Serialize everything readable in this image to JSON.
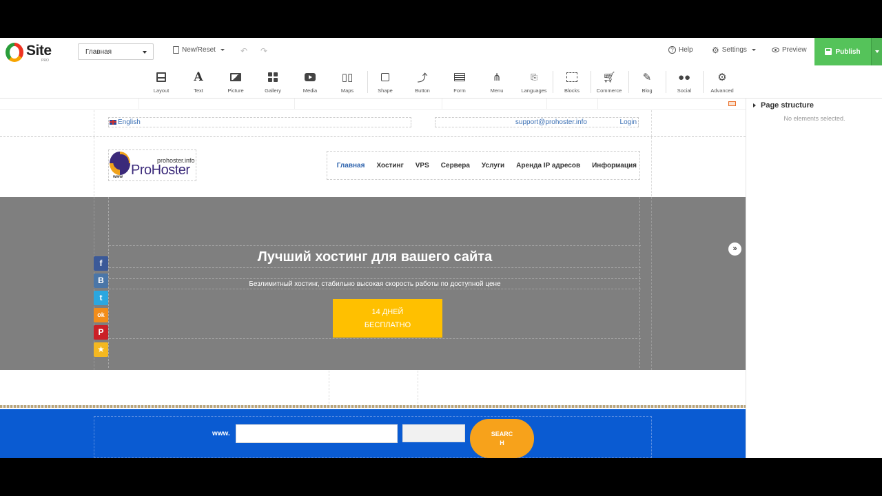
{
  "brand": {
    "name": "Site",
    "sub": "PRO"
  },
  "page_select": {
    "value": "Главная"
  },
  "topbar": {
    "new_reset": "New/Reset",
    "undo": "↶",
    "redo": "↷",
    "help": "Help",
    "settings": "Settings",
    "preview": "Preview",
    "publish": "Publish"
  },
  "tools": [
    {
      "label": "Layout",
      "icon": "layout-icon"
    },
    {
      "label": "Text",
      "icon": "text-icon"
    },
    {
      "label": "Picture",
      "icon": "picture-icon"
    },
    {
      "label": "Gallery",
      "icon": "gallery-icon"
    },
    {
      "label": "Media",
      "icon": "media-icon"
    },
    {
      "label": "Maps",
      "icon": "maps-icon"
    },
    {
      "label": "Shape",
      "icon": "shape-icon"
    },
    {
      "label": "Button",
      "icon": "button-icon"
    },
    {
      "label": "Form",
      "icon": "form-icon"
    },
    {
      "label": "Menu",
      "icon": "menu-icon"
    },
    {
      "label": "Languages",
      "icon": "languages-icon"
    },
    {
      "label": "Blocks",
      "icon": "blocks-icon"
    },
    {
      "label": "Commerce",
      "icon": "commerce-icon"
    },
    {
      "label": "Blog",
      "icon": "blog-icon"
    },
    {
      "label": "Social",
      "icon": "social-icon"
    },
    {
      "label": "Advanced",
      "icon": "advanced-icon"
    }
  ],
  "site": {
    "language": "English",
    "email": "support@prohoster.info",
    "login": "Login",
    "logo_domain": "prohoster.info",
    "logo_name": "ProHoster",
    "logo_www": "www",
    "nav": [
      "Главная",
      "Хостинг",
      "VPS",
      "Сервера",
      "Услуги",
      "Аренда IP адресов",
      "Информация"
    ],
    "hero_title": "Лучший хостинг для вашего сайта",
    "hero_subtitle": "Безлимитный хостинг, стабильно высокая скорость работы по доступной цене",
    "cta_line1": "14 ДНЕЙ",
    "cta_line2": "БЕСПЛАТНО",
    "next_arrow": "»",
    "social": [
      {
        "name": "facebook",
        "glyph": "f",
        "color": "#3b5998"
      },
      {
        "name": "vkontakte",
        "glyph": "B",
        "color": "#4a76a8"
      },
      {
        "name": "twitter",
        "glyph": "t",
        "color": "#2ba7e0"
      },
      {
        "name": "odnoklassniki",
        "glyph": "ok",
        "color": "#f28d1a"
      },
      {
        "name": "pinterest",
        "glyph": "P",
        "color": "#cb2027"
      },
      {
        "name": "bookmark",
        "glyph": "★",
        "color": "#f5b820"
      }
    ],
    "search_prefix": "www.",
    "search_btn_line1": "SEARC",
    "search_btn_line2": "H"
  },
  "panel": {
    "title": "Page structure",
    "empty": "No elements selected."
  },
  "colors": {
    "publish": "#55c35a",
    "hero": "#7f7f7f",
    "cta": "#ffc000",
    "search_band": "#0a5bd2",
    "search_btn": "#f7a21b"
  }
}
